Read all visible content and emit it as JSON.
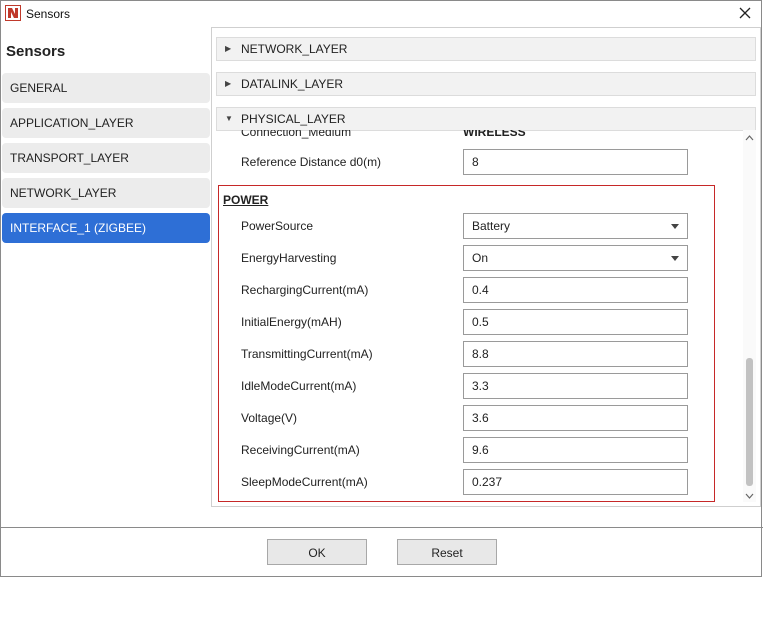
{
  "window": {
    "title": "Sensors"
  },
  "sidebar": {
    "title": "Sensors",
    "items": [
      {
        "label": "GENERAL"
      },
      {
        "label": "APPLICATION_LAYER"
      },
      {
        "label": "TRANSPORT_LAYER"
      },
      {
        "label": "NETWORK_LAYER"
      },
      {
        "label": "INTERFACE_1 (ZIGBEE)",
        "selected": true
      }
    ]
  },
  "accordion": {
    "sections": [
      {
        "label": "NETWORK_LAYER",
        "expanded": false
      },
      {
        "label": "DATALINK_LAYER",
        "expanded": false
      },
      {
        "label": "PHYSICAL_LAYER",
        "expanded": true
      }
    ]
  },
  "physical": {
    "connection_medium_label": "Connection_Medium",
    "connection_medium_value": "WIRELESS",
    "reference_distance_label": "Reference Distance d0(m)",
    "reference_distance_value": "8"
  },
  "power": {
    "heading": "POWER",
    "power_source": {
      "label": "PowerSource",
      "value": "Battery"
    },
    "energy_harvesting": {
      "label": "EnergyHarvesting",
      "value": "On"
    },
    "fields": [
      {
        "label": "RechargingCurrent(mA)",
        "value": "0.4"
      },
      {
        "label": "InitialEnergy(mAH)",
        "value": "0.5"
      },
      {
        "label": "TransmittingCurrent(mA)",
        "value": "8.8"
      },
      {
        "label": "IdleModeCurrent(mA)",
        "value": "3.3"
      },
      {
        "label": "Voltage(V)",
        "value": "3.6"
      },
      {
        "label": "ReceivingCurrent(mA)",
        "value": "9.6"
      },
      {
        "label": "SleepModeCurrent(mA)",
        "value": "0.237"
      }
    ]
  },
  "footer": {
    "ok_label": "OK",
    "reset_label": "Reset"
  },
  "colors": {
    "accent": "#2e6fd6",
    "power_border": "#c62828",
    "app_icon": "#c0392b"
  },
  "icons": {
    "app": "app-logo-icon",
    "close": "close-icon",
    "collapsed": "triangle-right-icon",
    "expanded": "triangle-down-icon"
  }
}
